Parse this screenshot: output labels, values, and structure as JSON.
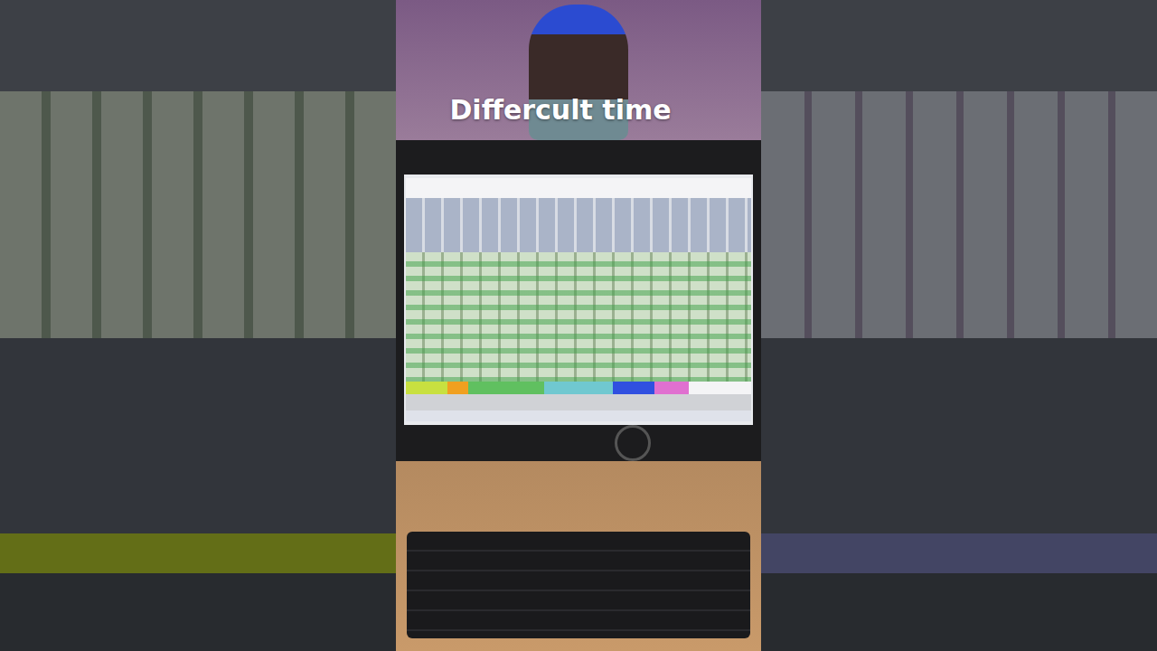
{
  "caption": {
    "text": "Differcult time"
  }
}
